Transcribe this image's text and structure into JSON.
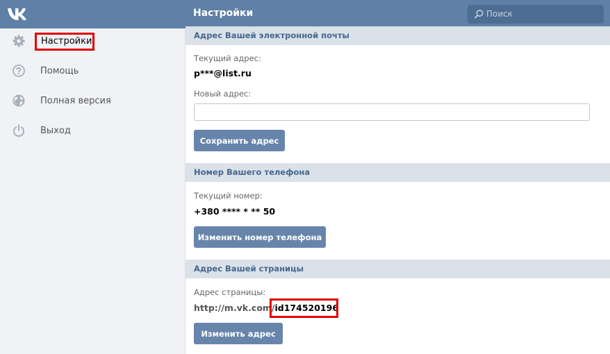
{
  "header": {
    "title": "Настройки",
    "search_placeholder": "Поиск",
    "logo_icon": "vk-logo-icon"
  },
  "sidebar": {
    "items": [
      {
        "label": "Настройки",
        "icon": "gear-icon",
        "active": true
      },
      {
        "label": "Помощь",
        "icon": "help-icon"
      },
      {
        "label": "Полная версия",
        "icon": "globe-icon"
      },
      {
        "label": "Выход",
        "icon": "power-icon"
      }
    ]
  },
  "email": {
    "section_title": "Адрес Вашей электронной почты",
    "current_label": "Текущий адрес:",
    "current_value": "p***@list.ru",
    "new_label": "Новый адрес:",
    "new_value": "",
    "save_button": "Сохранить адрес"
  },
  "phone": {
    "section_title": "Номер Вашего телефона",
    "current_label": "Текущий номер:",
    "current_value": "+380 **** * ** 50",
    "change_button": "Изменить номер телефона"
  },
  "page_address": {
    "section_title": "Адрес Вашей страницы",
    "label": "Адрес страницы:",
    "url_prefix": "http://m.vk.com/",
    "url_id": "id174520196",
    "change_button": "Изменить адрес"
  },
  "colors": {
    "header": "#5f80a7",
    "button": "#6785ab",
    "section_header": "#dae1e8",
    "highlight": "#e00000"
  }
}
